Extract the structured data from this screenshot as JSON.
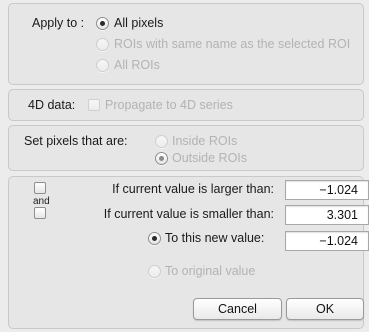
{
  "apply_to": {
    "label": "Apply to :",
    "options": [
      "All pixels",
      "ROIs with same name as the selected ROI",
      "All ROIs"
    ],
    "selected": "All pixels"
  },
  "fourd": {
    "label": "4D data:",
    "checkbox_label": "Propagate to 4D series"
  },
  "set_pixels": {
    "label": "Set pixels that are:",
    "options": [
      "Inside ROIs",
      "Outside ROIs"
    ],
    "selected": "Outside ROIs"
  },
  "conditions": {
    "and_label": "and",
    "larger_label": "If current value is larger than:",
    "larger_value": "−1.024",
    "smaller_label": "If current value is smaller than:",
    "smaller_value": "3.301",
    "new_value_label": "To this new value:",
    "new_value": "−1.024",
    "original_label": "To original value"
  },
  "buttons": {
    "cancel": "Cancel",
    "ok": "OK"
  }
}
